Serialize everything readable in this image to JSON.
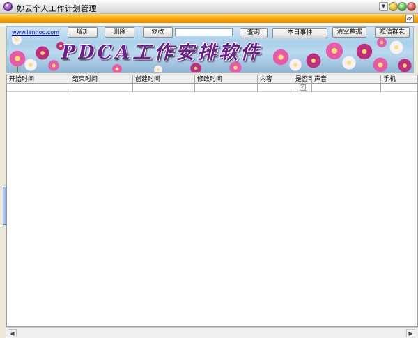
{
  "window": {
    "title": "妙云个人工作计划管理",
    "menu_glyph": "▼",
    "collapse_glyph": "≪"
  },
  "toolbar": {
    "link_text": "www.lanhoo.com",
    "add_label": "增加",
    "delete_label": "删除",
    "edit_label": "修改",
    "search_value": "",
    "query_label": "查询",
    "today_label": "本日事件",
    "clear_label": "清空数据",
    "sms_label": "短信群发"
  },
  "banner": {
    "title": "PDCA工作安排软件"
  },
  "grid": {
    "columns": [
      "开始时间",
      "结束时间",
      "创建时间",
      "修改时间",
      "内容",
      "是否可",
      "声音",
      "手机"
    ],
    "rows": [
      {
        "start": "",
        "end": "",
        "created": "",
        "modified": "",
        "content": "",
        "enabled": true,
        "sound": "",
        "phone": ""
      }
    ]
  },
  "colors": {
    "accent_orange": "#f6a300",
    "banner_text": "#6b1f8f"
  }
}
